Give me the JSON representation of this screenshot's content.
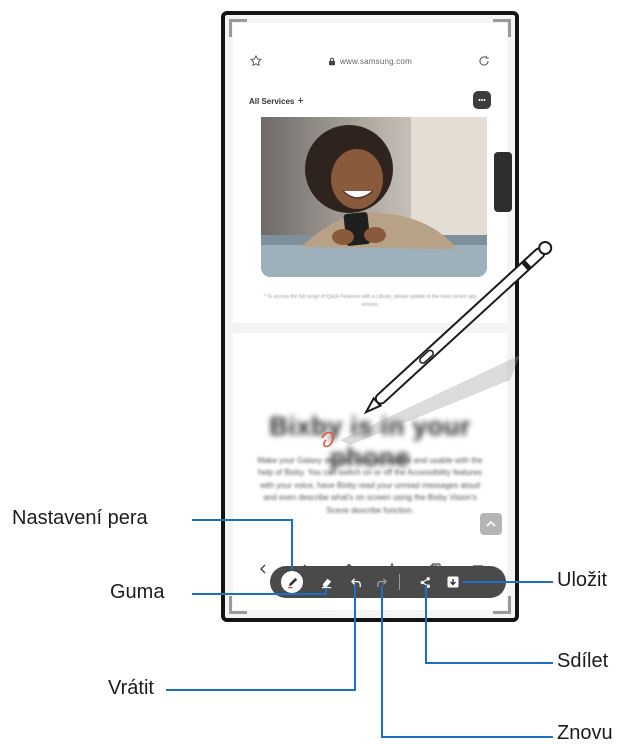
{
  "browser": {
    "url": "www.samsung.com",
    "site_brand": "All Services",
    "site_brand_plus": "+"
  },
  "content": {
    "caption": "* To access the full range of Quick Features with a Library, please update to the most recent app version.",
    "blurred_title": "Bixby is in your phone",
    "blurred_body": "Make your Galaxy devices more accessible and usable with the help of Bixby. You can switch on or off the Accessibility features with your voice, have Bixby read your unread messages aloud and even describe what's on screen using the Bixby Vision's Scene describe function."
  },
  "nav_icons": [
    "chevron-left-icon",
    "chevron-right-icon",
    "home-icon",
    "bookmark-star-icon",
    "tabs-icon",
    "menu-icon"
  ],
  "toolbar_icons": [
    "pen-icon",
    "eraser-icon",
    "undo-icon",
    "redo-icon",
    "share-icon",
    "save-icon"
  ],
  "callouts": {
    "pen_settings": "Nastavení pera",
    "eraser": "Guma",
    "undo": "Vrátit",
    "save": "Uložit",
    "share": "Sdílet",
    "redo": "Znovu"
  },
  "colors": {
    "callout_line": "#1e6fc4",
    "toolbar_bg": "#4a4a4a",
    "pen_accent": "#e0573b"
  }
}
